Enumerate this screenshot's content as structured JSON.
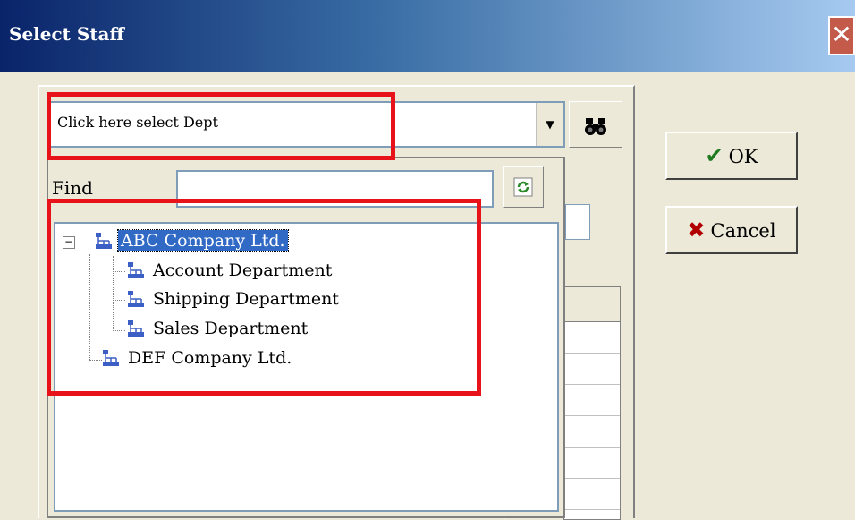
{
  "window": {
    "title": "Select Staff",
    "close_label": "✕"
  },
  "dept_combo": {
    "value": "Click here select Dept",
    "arrow": "▼"
  },
  "search_button": {
    "icon": "binoculars-icon",
    "glyph": "🔭"
  },
  "find": {
    "label": "Find",
    "value": ""
  },
  "refresh_button": {
    "icon": "refresh-icon",
    "glyph": "↻"
  },
  "tree": {
    "expander": "−",
    "nodes": [
      {
        "label": "ABC Company Ltd.",
        "level": 0,
        "selected": true
      },
      {
        "label": "Account Department",
        "level": 1
      },
      {
        "label": "Shipping Department",
        "level": 1
      },
      {
        "label": "Sales Department",
        "level": 1
      },
      {
        "label": "DEF Company Ltd.",
        "level": 0
      }
    ]
  },
  "buttons": {
    "ok": {
      "label": "OK",
      "glyph": "✔",
      "color": "#1f7a1f"
    },
    "cancel": {
      "label": "Cancel",
      "glyph": "✖",
      "color": "#b00000"
    }
  },
  "colors": {
    "highlight": "#e8121a",
    "selection": "#316ac5"
  }
}
